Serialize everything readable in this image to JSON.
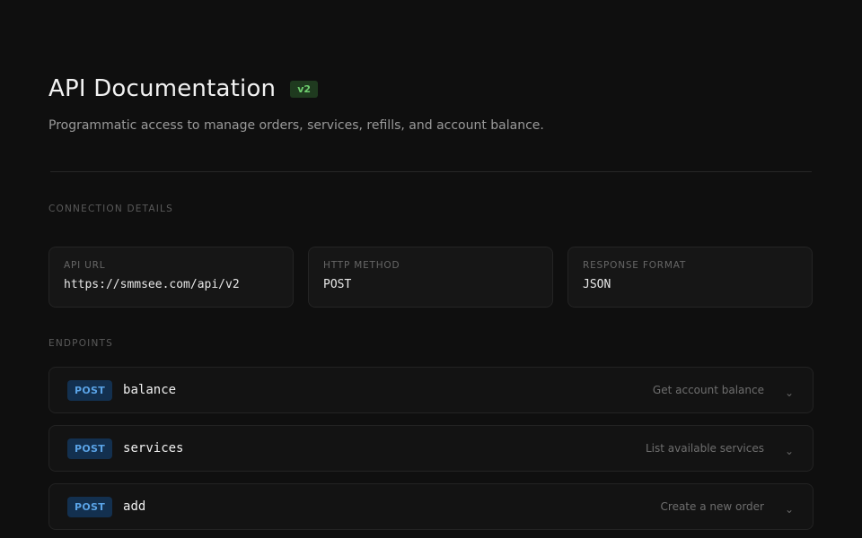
{
  "header": {
    "title": "API Documentation",
    "version": "v2",
    "subtitle": "Programmatic access to manage orders, services, refills, and account balance."
  },
  "connection": {
    "section_label": "CONNECTION DETAILS",
    "cards": [
      {
        "label": "API URL",
        "value": "https://smmsee.com/api/v2"
      },
      {
        "label": "HTTP METHOD",
        "value": "POST"
      },
      {
        "label": "RESPONSE FORMAT",
        "value": "JSON"
      }
    ]
  },
  "endpoints": {
    "section_label": "ENDPOINTS",
    "items": [
      {
        "method": "POST",
        "name": "balance",
        "description": "Get account balance"
      },
      {
        "method": "POST",
        "name": "services",
        "description": "List available services"
      },
      {
        "method": "POST",
        "name": "add",
        "description": "Create a new order"
      }
    ]
  },
  "icons": {
    "expand": "chevron-down-icon"
  },
  "colors": {
    "background": "#0f0f0f",
    "version_badge_bg": "#1f3a1f",
    "version_badge_fg": "#6fcf6f",
    "method_bg": "#13304f",
    "method_fg": "#5aa3e6"
  }
}
